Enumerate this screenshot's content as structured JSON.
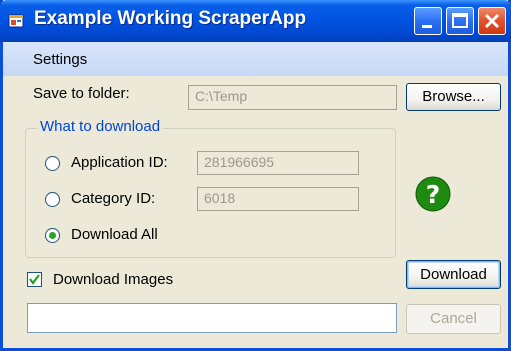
{
  "window": {
    "title": "Example Working ScraperApp",
    "accent_color": "#0054e3",
    "title_icon": "app-window-icon"
  },
  "titlebar_buttons": {
    "minimize_icon": "minimize-icon",
    "maximize_icon": "maximize-icon",
    "close_icon": "close-icon"
  },
  "menu": {
    "items": [
      {
        "label": "Settings"
      }
    ]
  },
  "save_folder": {
    "label": "Save to folder:",
    "value": "C:\\Temp",
    "browse_label": "Browse..."
  },
  "download_group": {
    "title": "What to download",
    "options": [
      {
        "label": "Application ID:",
        "value": "281966695",
        "selected": false
      },
      {
        "label": "Category ID:",
        "value": "6018",
        "selected": false
      },
      {
        "label": "Download All",
        "selected": true
      }
    ],
    "radio_color": "#24a524"
  },
  "help": {
    "icon": "help-question-icon",
    "color": "#1f8a10"
  },
  "download_images": {
    "label": "Download Images",
    "checked": true
  },
  "actions": {
    "download_label": "Download",
    "cancel_label": "Cancel",
    "status_value": ""
  }
}
